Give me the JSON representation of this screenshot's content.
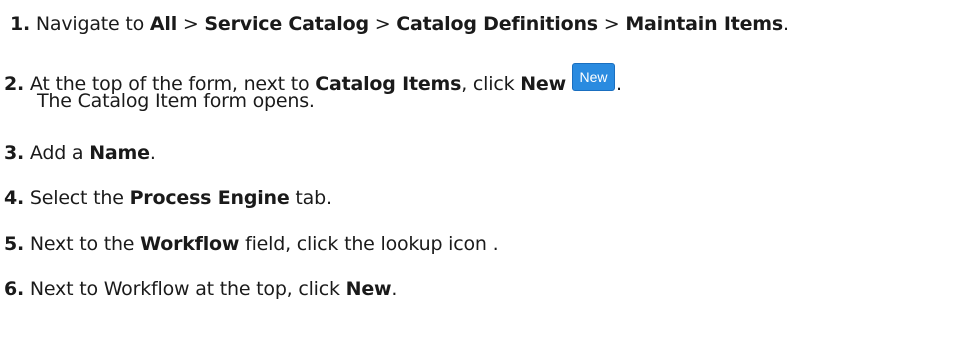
{
  "steps": [
    {
      "number": "1.",
      "t1": "Navigate to ",
      "b1": "All",
      "t2": " > ",
      "b2": "Service Catalog",
      "t3": " > ",
      "b3": "Catalog Definitions",
      "t4": " > ",
      "b4": "Maintain Items",
      "t5": "."
    },
    {
      "number": "2.",
      "t1": "At the top of the form, next to ",
      "b1": "Catalog Items",
      "t2": ", click ",
      "b2": "New",
      "button_label": "New",
      "t3": ".",
      "sub": "The Catalog Item form opens."
    },
    {
      "number": "3.",
      "t1": "Add a ",
      "b1": "Name",
      "t2": "."
    },
    {
      "number": "4.",
      "t1": "Select the ",
      "b1": "Process Engine",
      "t2": " tab."
    },
    {
      "number": "5.",
      "t1": "Next to the ",
      "b1": "Workflow",
      "t2": " field, click the lookup icon ."
    },
    {
      "number": "6.",
      "t1": "Next to Workflow at the top, click ",
      "b1": "New",
      "t2": "."
    }
  ],
  "colors": {
    "text": "#1a1a1a",
    "button_bg": "#2a8be0",
    "button_text": "#ffffff"
  }
}
